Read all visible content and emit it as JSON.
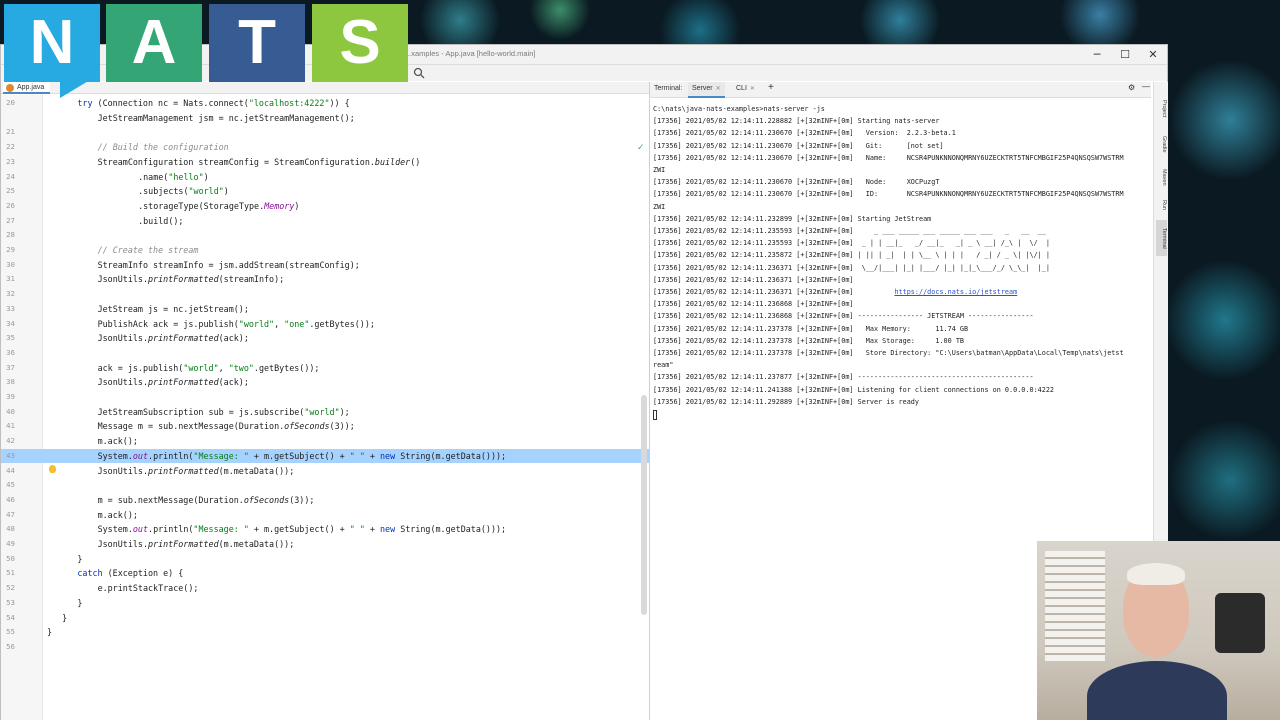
{
  "logo": {
    "letters": [
      "N",
      "A",
      "T",
      "S"
    ],
    "colors": [
      "#27aae1",
      "#34a574",
      "#375c93",
      "#8dc63f"
    ]
  },
  "window": {
    "title": "...xamples - App.java [hello-world.main]",
    "controls": {
      "minimize": "─",
      "maximize": "☐",
      "close": "✕"
    }
  },
  "editor": {
    "tab_label": "App.java",
    "lines": [
      {
        "num": "20",
        "html": "<span class=\"kw\">try</span> (Connection nc = Nats.connect(<span class=\"str\">\"localhost:4222\"</span>)) {",
        "indent": 6
      },
      {
        "num": "",
        "html": "JetStreamManagement jsm = nc.jetStreamManagement();",
        "indent": 10
      },
      {
        "num": "21",
        "html": "",
        "indent": 0
      },
      {
        "num": "22",
        "html": "<span class=\"cm\">// Build the configuration</span>",
        "indent": 10
      },
      {
        "num": "23",
        "html": "StreamConfiguration streamConfig = StreamConfiguration.<span class=\"it\">builder</span>()",
        "indent": 10
      },
      {
        "num": "24",
        "html": ".name(<span class=\"str\">\"hello\"</span>)",
        "indent": 18
      },
      {
        "num": "25",
        "html": ".subjects(<span class=\"str\">\"world\"</span>)",
        "indent": 18
      },
      {
        "num": "26",
        "html": ".storageType(StorageType.<span class=\"field\">Memory</span>)",
        "indent": 18
      },
      {
        "num": "27",
        "html": ".build();",
        "indent": 18
      },
      {
        "num": "28",
        "html": "",
        "indent": 0
      },
      {
        "num": "29",
        "html": "<span class=\"cm\">// Create the stream</span>",
        "indent": 10
      },
      {
        "num": "30",
        "html": "StreamInfo streamInfo = jsm.addStream(streamConfig);",
        "indent": 10
      },
      {
        "num": "31",
        "html": "JsonUtils.<span class=\"it\">printFormatted</span>(streamInfo);",
        "indent": 10
      },
      {
        "num": "32",
        "html": "",
        "indent": 0
      },
      {
        "num": "33",
        "html": "JetStream js = nc.jetStream();",
        "indent": 10
      },
      {
        "num": "34",
        "html": "PublishAck ack = js.publish(<span class=\"str\">\"world\"</span>, <span class=\"str\">\"one\"</span>.getBytes());",
        "indent": 10
      },
      {
        "num": "35",
        "html": "JsonUtils.<span class=\"it\">printFormatted</span>(ack);",
        "indent": 10
      },
      {
        "num": "36",
        "html": "",
        "indent": 0
      },
      {
        "num": "37",
        "html": "ack = js.publish(<span class=\"str\">\"world\"</span>, <span class=\"str\">\"two\"</span>.getBytes());",
        "indent": 10
      },
      {
        "num": "38",
        "html": "JsonUtils.<span class=\"it\">printFormatted</span>(ack);",
        "indent": 10
      },
      {
        "num": "39",
        "html": "",
        "indent": 0
      },
      {
        "num": "40",
        "html": "JetStreamSubscription sub = js.subscribe(<span class=\"str\">\"world\"</span>);",
        "indent": 10
      },
      {
        "num": "41",
        "html": "Message m = sub.nextMessage(Duration.<span class=\"it\">ofSeconds</span>(3));",
        "indent": 10
      },
      {
        "num": "42",
        "html": "m.ack();",
        "indent": 10
      },
      {
        "num": "43",
        "html": "System.<span class=\"field\">out</span>.println(<span class=\"str\">\"Message: \"</span> + m.getSubject() + <span class=\"str\">\" \"</span> + <span class=\"kw\">new</span> String(m.getData()));",
        "indent": 10,
        "highlight": true
      },
      {
        "num": "44",
        "html": "JsonUtils.<span class=\"it\">printFormatted</span>(m.metaData());",
        "indent": 10
      },
      {
        "num": "45",
        "html": "",
        "indent": 0
      },
      {
        "num": "46",
        "html": "m = sub.nextMessage(Duration.<span class=\"it\">ofSeconds</span>(3));",
        "indent": 10
      },
      {
        "num": "47",
        "html": "m.ack();",
        "indent": 10
      },
      {
        "num": "48",
        "html": "System.<span class=\"field\">out</span>.println(<span class=\"str\">\"Message: \"</span> + m.getSubject() + <span class=\"str\">\" \"</span> + <span class=\"kw\">new</span> String(m.getData()));",
        "indent": 10
      },
      {
        "num": "49",
        "html": "JsonUtils.<span class=\"it\">printFormatted</span>(m.metaData());",
        "indent": 10
      },
      {
        "num": "50",
        "html": "}",
        "indent": 6
      },
      {
        "num": "51",
        "html": "<span class=\"kw\">catch</span> (Exception e) {",
        "indent": 6
      },
      {
        "num": "52",
        "html": "e.printStackTrace();",
        "indent": 10
      },
      {
        "num": "53",
        "html": "}",
        "indent": 6
      },
      {
        "num": "54",
        "html": "}",
        "indent": 3
      },
      {
        "num": "55",
        "html": "}",
        "indent": 0
      },
      {
        "num": "56",
        "html": "",
        "indent": 0
      }
    ]
  },
  "terminal": {
    "label": "Terminal:",
    "tabs": [
      {
        "label": "Server",
        "active": true
      },
      {
        "label": "CLI",
        "active": false
      }
    ],
    "add": "+",
    "lines": [
      {
        "text": "C:\\nats\\java-nats-examples>nats-server -js"
      },
      {
        "text": "[17356] 2021/05/02 12:14:11.228882 [+[32mINF+[0m] Starting nats-server"
      },
      {
        "text": "[17356] 2021/05/02 12:14:11.230670 [+[32mINF+[0m]   Version:  2.2.3-beta.1"
      },
      {
        "text": "[17356] 2021/05/02 12:14:11.230670 [+[32mINF+[0m]   Git:      [not set]"
      },
      {
        "text": "[17356] 2021/05/02 12:14:11.230670 [+[32mINF+[0m]   Name:     NCSR4PUNKNNONQMRNY6UZECKTRT5TNFCMBGIF25P4QNSQSW7WSTRM"
      },
      {
        "text": "ZWI"
      },
      {
        "text": "[17356] 2021/05/02 12:14:11.230670 [+[32mINF+[0m]   Node:     XOCPuzgT"
      },
      {
        "text": "[17356] 2021/05/02 12:14:11.230670 [+[32mINF+[0m]   ID:       NCSR4PUNKNNONQMRNY6UZECKTRT5TNFCMBGIF25P4QNSQSW7WSTRM"
      },
      {
        "text": "ZWI"
      },
      {
        "text": "[17356] 2021/05/02 12:14:11.232899 [+[32mINF+[0m] Starting JetStream"
      },
      {
        "text": "[17356] 2021/05/02 12:14:11.235593 [+[32mINF+[0m]     _ ___ _____ ___ _____ ___ ___   _   __  __"
      },
      {
        "text": "[17356] 2021/05/02 12:14:11.235593 [+[32mINF+[0m]  _ | | __|_   _/ __|_   _| _ \\ __| /_\\ |  \\/  |"
      },
      {
        "text": "[17356] 2021/05/02 12:14:11.235872 [+[32mINF+[0m] | || | _|  | | \\__ \\ | | |   / _| / _ \\| |\\/| |"
      },
      {
        "text": "[17356] 2021/05/02 12:14:11.236371 [+[32mINF+[0m]  \\__/|___| |_| |___/ |_| |_|_\\___/_/ \\_\\_|  |_|"
      },
      {
        "text": "[17356] 2021/05/02 12:14:11.236371 [+[32mINF+[0m]"
      },
      {
        "text": "[17356] 2021/05/02 12:14:11.236371 [+[32mINF+[0m]          ",
        "link": "https://docs.nats.io/jetstream"
      },
      {
        "text": "[17356] 2021/05/02 12:14:11.236868 [+[32mINF+[0m]"
      },
      {
        "text": "[17356] 2021/05/02 12:14:11.236868 [+[32mINF+[0m] ---------------- JETSTREAM ----------------"
      },
      {
        "text": "[17356] 2021/05/02 12:14:11.237378 [+[32mINF+[0m]   Max Memory:      11.74 GB"
      },
      {
        "text": "[17356] 2021/05/02 12:14:11.237378 [+[32mINF+[0m]   Max Storage:     1.00 TB"
      },
      {
        "text": "[17356] 2021/05/02 12:14:11.237378 [+[32mINF+[0m]   Store Directory: \"C:\\Users\\batman\\AppData\\Local\\Temp\\nats\\jetst"
      },
      {
        "text": "ream\""
      },
      {
        "text": "[17356] 2021/05/02 12:14:11.237877 [+[32mINF+[0m] -------------------------------------------"
      },
      {
        "text": "[17356] 2021/05/02 12:14:11.241388 [+[32mINF+[0m] Listening for client connections on 0.0.0.0:4222"
      },
      {
        "text": "[17356] 2021/05/02 12:14:11.292889 [+[32mINF+[0m] Server is ready"
      }
    ]
  },
  "tool_strip": {
    "items": [
      "Project",
      "Gradle",
      "Maven",
      "Run",
      "Terminal"
    ]
  }
}
